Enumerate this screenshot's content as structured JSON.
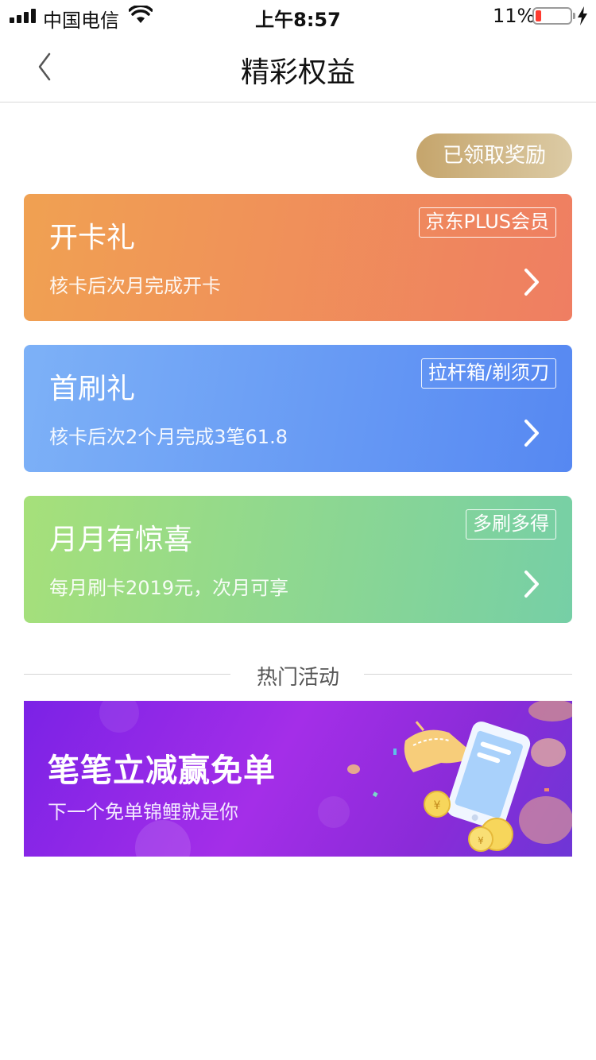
{
  "status_bar": {
    "carrier": "中国电信",
    "time": "上午8:57",
    "battery_pct": "11%"
  },
  "nav": {
    "title": "精彩权益",
    "back_icon": "chevron-left-icon"
  },
  "claimed_button": {
    "label": "已领取奖励"
  },
  "cards": [
    {
      "title": "开卡礼",
      "subtitle": "核卡后次月完成开卡",
      "tag": "京东PLUS会员"
    },
    {
      "title": "首刷礼",
      "subtitle": "核卡后次2个月完成3笔61.8",
      "tag": "拉杆箱/剃须刀"
    },
    {
      "title": "月月有惊喜",
      "subtitle": "每月刷卡2019元，次月可享",
      "tag": "多刷多得"
    }
  ],
  "hot_section": {
    "title": "热门活动"
  },
  "banner": {
    "title": "笔笔立减赢免单",
    "subtitle": "下一个免单锦鲤就是你"
  },
  "colors": {
    "card_orange": "#f0a152",
    "card_blue": "#5688f2",
    "card_green": "#76cfa6",
    "gold": "#c5a56c",
    "banner_purple": "#8a2bd8"
  }
}
